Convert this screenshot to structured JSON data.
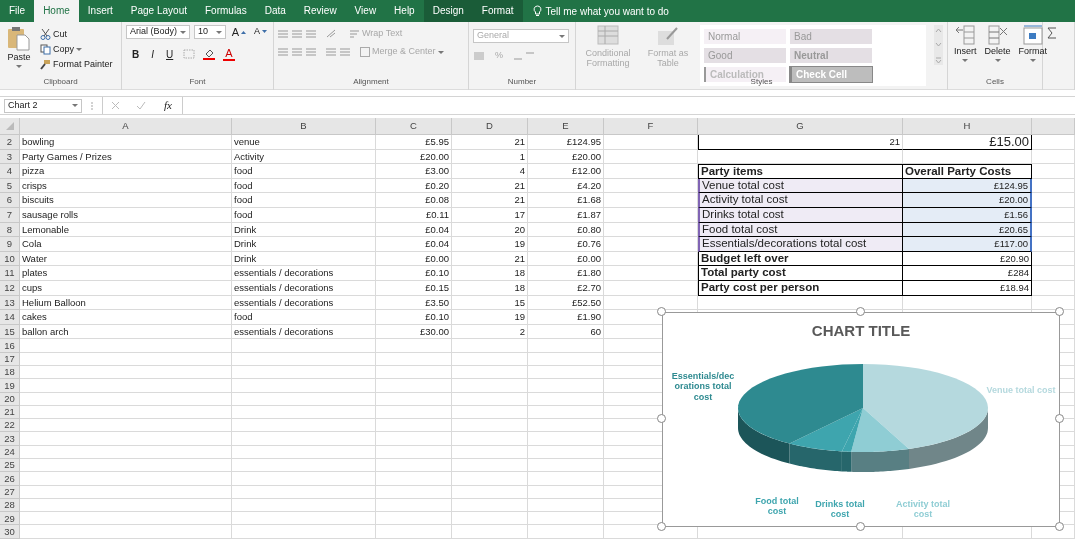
{
  "ribbon_tabs": [
    {
      "label": "File",
      "selected": false,
      "contextual": false
    },
    {
      "label": "Home",
      "selected": true,
      "contextual": false
    },
    {
      "label": "Insert",
      "selected": false,
      "contextual": false
    },
    {
      "label": "Page Layout",
      "selected": false,
      "contextual": false
    },
    {
      "label": "Formulas",
      "selected": false,
      "contextual": false
    },
    {
      "label": "Data",
      "selected": false,
      "contextual": false
    },
    {
      "label": "Review",
      "selected": false,
      "contextual": false
    },
    {
      "label": "View",
      "selected": false,
      "contextual": false
    },
    {
      "label": "Help",
      "selected": false,
      "contextual": false
    },
    {
      "label": "Design",
      "selected": false,
      "contextual": true
    },
    {
      "label": "Format",
      "selected": false,
      "contextual": true
    }
  ],
  "tell_me": "Tell me what you want to do",
  "clipboard": {
    "label": "Clipboard",
    "paste": "Paste",
    "cut": "Cut",
    "copy": "Copy",
    "format_painter": "Format Painter"
  },
  "font": {
    "label": "Font",
    "name": "Arial (Body)",
    "size": "10",
    "grow": "A",
    "shrink": "A",
    "style_buttons": [
      "B",
      "I",
      "U"
    ],
    "color_letter": "A"
  },
  "alignment": {
    "label": "Alignment",
    "disabled": true,
    "wrap_text": "Wrap Text",
    "merge_center": "Merge & Center"
  },
  "number": {
    "label": "Number",
    "disabled": true,
    "format": "General",
    "percent": "%"
  },
  "styles": {
    "label": "Styles",
    "disabled": true,
    "conditional": "Conditional Formatting",
    "format_table": "Format as Table",
    "cell_styles": [
      {
        "label": "Normal",
        "kind": "normal"
      },
      {
        "label": "Bad",
        "kind": "bad"
      },
      {
        "label": "Good",
        "kind": "good"
      },
      {
        "label": "Neutral",
        "kind": "neutral"
      },
      {
        "label": "Calculation",
        "kind": "calculation"
      },
      {
        "label": "Check Cell",
        "kind": "check"
      }
    ]
  },
  "cells": {
    "label": "Cells",
    "buttons": [
      "Insert",
      "Delete",
      "Format"
    ]
  },
  "name_box": "Chart 2",
  "function_button": "fx",
  "columns": [
    "A",
    "B",
    "C",
    "D",
    "E",
    "F",
    "G",
    "H"
  ],
  "rows": [
    {
      "number": "2",
      "cells": [
        "bowling",
        "venue",
        "£5.95",
        "21",
        "£124.95"
      ]
    },
    {
      "number": "3",
      "cells": [
        "Party Games / Prizes",
        "Activity",
        "£20.00",
        "1",
        "£20.00"
      ]
    },
    {
      "number": "4",
      "cells": [
        "pizza",
        "food",
        "£3.00",
        "4",
        "£12.00"
      ]
    },
    {
      "number": "5",
      "cells": [
        "crisps",
        "food",
        "£0.20",
        "21",
        "£4.20"
      ]
    },
    {
      "number": "6",
      "cells": [
        "biscuits",
        "food",
        "£0.08",
        "21",
        "£1.68"
      ]
    },
    {
      "number": "7",
      "cells": [
        "sausage rolls",
        "food",
        "£0.11",
        "17",
        "£1.87"
      ]
    },
    {
      "number": "8",
      "cells": [
        "Lemonable",
        "Drink",
        "£0.04",
        "20",
        "£0.80"
      ]
    },
    {
      "number": "9",
      "cells": [
        "Cola",
        "Drink",
        "£0.04",
        "19",
        "£0.76"
      ]
    },
    {
      "number": "10",
      "cells": [
        "Water",
        "Drink",
        "£0.00",
        "21",
        "£0.00"
      ]
    },
    {
      "number": "11",
      "cells": [
        "plates",
        "essentials / decorations",
        "£0.10",
        "18",
        "£1.80"
      ]
    },
    {
      "number": "12",
      "cells": [
        "cups",
        "essentials / decorations",
        "£0.15",
        "18",
        "£2.70"
      ]
    },
    {
      "number": "13",
      "cells": [
        "Helium Balloon",
        "essentials / decorations",
        "£3.50",
        "15",
        "£52.50"
      ]
    },
    {
      "number": "14",
      "cells": [
        "cakes",
        "food",
        "£0.10",
        "19",
        "£1.90"
      ]
    },
    {
      "number": "15",
      "cells": [
        "ballon arch",
        "essentials / decorations",
        "£30.00",
        "2",
        "60"
      ]
    },
    {
      "number": "16"
    },
    {
      "number": "17"
    },
    {
      "number": "18"
    },
    {
      "number": "19"
    },
    {
      "number": "20"
    },
    {
      "number": "21"
    },
    {
      "number": "22"
    },
    {
      "number": "23"
    },
    {
      "number": "24"
    },
    {
      "number": "25"
    },
    {
      "number": "26"
    },
    {
      "number": "27"
    },
    {
      "number": "28"
    },
    {
      "number": "29"
    },
    {
      "number": "30"
    }
  ],
  "row_2_values": [
    "21",
    "£15.00"
  ],
  "summary": [
    {
      "label": "Party items",
      "value": "Overall Party Costs",
      "kind": "header"
    },
    {
      "label": "Venue total cost",
      "value": "£124.95",
      "kind": "item"
    },
    {
      "label": "Activity total cost",
      "value": "£20.00",
      "kind": "item"
    },
    {
      "label": "Drinks total cost",
      "value": "£1.56",
      "kind": "item"
    },
    {
      "label": "Food total cost",
      "value": "£20.65",
      "kind": "item"
    },
    {
      "label": "Essentials/decorations total cost",
      "value": "£117.00",
      "kind": "item"
    },
    {
      "label": "Budget left over",
      "value": "£20.90",
      "kind": "total"
    },
    {
      "label": "Total party cost",
      "value": "£284",
      "kind": "total"
    },
    {
      "label": "Party cost per person",
      "value": "£18.94",
      "kind": "total"
    }
  ],
  "chart": {
    "title": "CHART TITLE",
    "labels": [
      {
        "text": "Essentials/decorations total cost",
        "color": "#2e8a90"
      },
      {
        "text": "Venue total cost",
        "color": "#b5d9de"
      },
      {
        "text": "Food total cost",
        "color": "#3ea5ae"
      },
      {
        "text": "Drinks total cost",
        "color": "#3ea5ae"
      },
      {
        "text": "Activity total cost",
        "color": "#8fcdd4"
      }
    ]
  }
}
